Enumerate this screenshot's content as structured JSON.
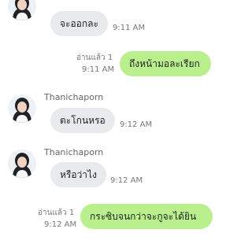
{
  "messages": [
    {
      "direction": "incoming",
      "text": "จะออกละ",
      "time": "9:11 AM"
    },
    {
      "direction": "outgoing",
      "read": "อ่านแล้ว 1",
      "text": "ถึงหน้ามอละเรียก",
      "time": "9:11 AM"
    },
    {
      "direction": "incoming",
      "sender": "Thanichaporn",
      "text": "ตะโกนหรอ",
      "time": "9:12 AM"
    },
    {
      "direction": "incoming",
      "sender": "Thanichaporn",
      "text": "หรือว่าไง",
      "time": "9:12 AM"
    },
    {
      "direction": "outgoing",
      "read": "อ่านแล้ว 1",
      "text": "กระซิบจนกว่าจะกูจะได้ยิน",
      "time": "9:12 AM"
    }
  ],
  "colors": {
    "incoming_bubble": "#e9eaee",
    "outgoing_bubble": "#b9ef8d"
  },
  "icons": {
    "avatar": "contact-avatar-photo"
  }
}
